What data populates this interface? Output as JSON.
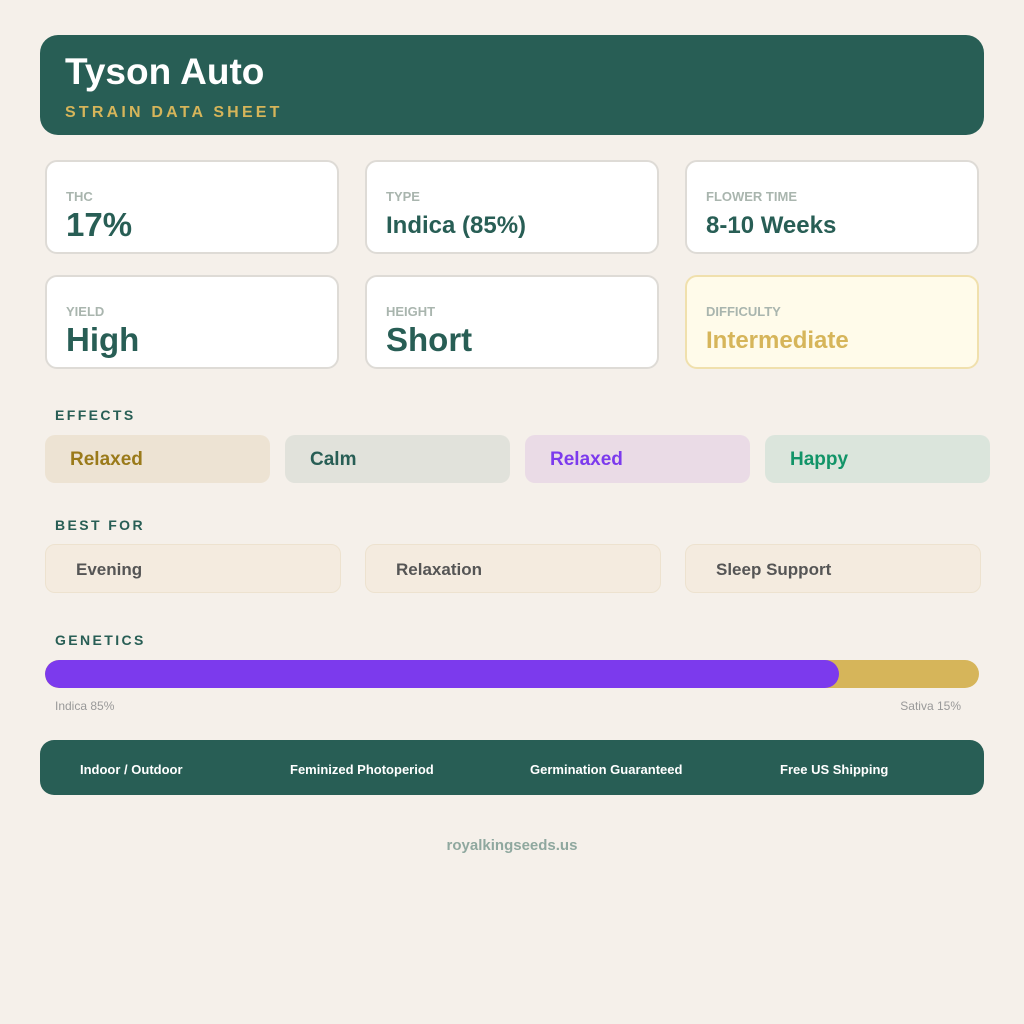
{
  "header": {
    "title": "Tyson Auto",
    "subtitle": "STRAIN DATA SHEET"
  },
  "stats": [
    {
      "label": "THC",
      "value": "17%"
    },
    {
      "label": "TYPE",
      "value": "Indica (85%)"
    },
    {
      "label": "FLOWER TIME",
      "value": "8-10 Weeks"
    },
    {
      "label": "YIELD",
      "value": "High"
    },
    {
      "label": "HEIGHT",
      "value": "Short"
    },
    {
      "label": "DIFFICULTY",
      "value": "Intermediate"
    }
  ],
  "effects": {
    "title": "EFFECTS",
    "items": [
      {
        "label": "Relaxed",
        "bg": "#ede3d3",
        "color": "#9a7a1a"
      },
      {
        "label": "Calm",
        "bg": "#e1e2db",
        "color": "#285e55"
      },
      {
        "label": "Relaxed",
        "bg": "#eadbe6",
        "color": "#7c3aed"
      },
      {
        "label": "Happy",
        "bg": "#dbe5dc",
        "color": "#129468"
      }
    ]
  },
  "best_for": {
    "title": "BEST FOR",
    "items": [
      "Evening",
      "Relaxation",
      "Sleep Support"
    ]
  },
  "genetics": {
    "title": "GENETICS",
    "indica_percent": 85,
    "sativa_percent": 15,
    "indica_label": "Indica 85%",
    "sativa_label": "Sativa 15%",
    "indica_color": "#7c3aed",
    "sativa_color": "#d6b55a"
  },
  "features": [
    "Indoor / Outdoor",
    "Feminized Photoperiod",
    "Germination Guaranteed",
    "Free US Shipping"
  ],
  "website": "royalkingseeds.us",
  "colors": {
    "primary": "#285e55",
    "accent": "#d6b55a",
    "background": "#f5f0ea"
  }
}
